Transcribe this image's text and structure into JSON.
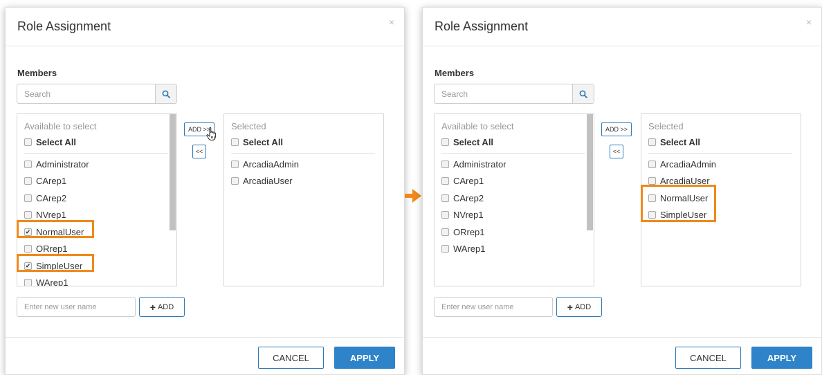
{
  "colors": {
    "accent": "#2e83c9",
    "highlight": "#f0891b",
    "arrow": "#f0891b"
  },
  "icons": {
    "search": "search-icon",
    "close": "close-icon",
    "cursor": "hand-pointer-icon",
    "arrow": "arrow-right-icon"
  },
  "left": {
    "title": "Role Assignment",
    "close": "×",
    "members_label": "Members",
    "search_placeholder": "Search",
    "available": {
      "heading": "Available to select",
      "select_all": "Select All",
      "items": [
        {
          "label": "Administrator",
          "checked": false
        },
        {
          "label": "CArep1",
          "checked": false
        },
        {
          "label": "CArep2",
          "checked": false
        },
        {
          "label": "NVrep1",
          "checked": false
        },
        {
          "label": "NormalUser",
          "checked": true
        },
        {
          "label": "ORrep1",
          "checked": false
        },
        {
          "label": "SimpleUser",
          "checked": true
        },
        {
          "label": "WArep1",
          "checked": false
        }
      ]
    },
    "selected": {
      "heading": "Selected",
      "select_all": "Select All",
      "items": [
        {
          "label": "ArcadiaAdmin",
          "checked": false
        },
        {
          "label": "ArcadiaUser",
          "checked": false
        }
      ]
    },
    "add_button": "ADD >>",
    "remove_button": "<<",
    "new_user_placeholder": "Enter new user name",
    "add_user_button": "ADD",
    "cancel": "CANCEL",
    "apply": "APPLY"
  },
  "right": {
    "title": "Role Assignment",
    "close": "×",
    "members_label": "Members",
    "search_placeholder": "Search",
    "available": {
      "heading": "Available to select",
      "select_all": "Select All",
      "items": [
        {
          "label": "Administrator",
          "checked": false
        },
        {
          "label": "CArep1",
          "checked": false
        },
        {
          "label": "CArep2",
          "checked": false
        },
        {
          "label": "NVrep1",
          "checked": false
        },
        {
          "label": "ORrep1",
          "checked": false
        },
        {
          "label": "WArep1",
          "checked": false
        }
      ]
    },
    "selected": {
      "heading": "Selected",
      "select_all": "Select All",
      "items": [
        {
          "label": "ArcadiaAdmin",
          "checked": false
        },
        {
          "label": "ArcadiaUser",
          "checked": false
        },
        {
          "label": "NormalUser",
          "checked": false
        },
        {
          "label": "SimpleUser",
          "checked": false
        }
      ]
    },
    "add_button": "ADD >>",
    "remove_button": "<<",
    "new_user_placeholder": "Enter new user name",
    "add_user_button": "ADD",
    "cancel": "CANCEL",
    "apply": "APPLY"
  }
}
